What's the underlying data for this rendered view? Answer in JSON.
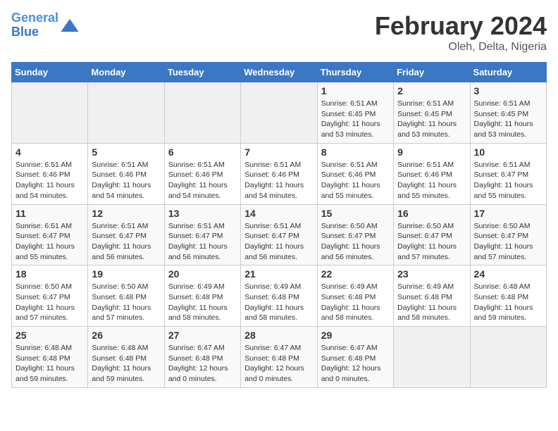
{
  "logo": {
    "line1": "General",
    "line2": "Blue"
  },
  "title": "February 2024",
  "subtitle": "Oleh, Delta, Nigeria",
  "weekdays": [
    "Sunday",
    "Monday",
    "Tuesday",
    "Wednesday",
    "Thursday",
    "Friday",
    "Saturday"
  ],
  "weeks": [
    [
      {
        "day": "",
        "empty": true
      },
      {
        "day": "",
        "empty": true
      },
      {
        "day": "",
        "empty": true
      },
      {
        "day": "",
        "empty": true
      },
      {
        "day": "1",
        "sunrise": "6:51 AM",
        "sunset": "6:45 PM",
        "daylight": "11 hours and 53 minutes."
      },
      {
        "day": "2",
        "sunrise": "6:51 AM",
        "sunset": "6:45 PM",
        "daylight": "11 hours and 53 minutes."
      },
      {
        "day": "3",
        "sunrise": "6:51 AM",
        "sunset": "6:45 PM",
        "daylight": "11 hours and 53 minutes."
      }
    ],
    [
      {
        "day": "4",
        "sunrise": "6:51 AM",
        "sunset": "6:46 PM",
        "daylight": "11 hours and 54 minutes."
      },
      {
        "day": "5",
        "sunrise": "6:51 AM",
        "sunset": "6:46 PM",
        "daylight": "11 hours and 54 minutes."
      },
      {
        "day": "6",
        "sunrise": "6:51 AM",
        "sunset": "6:46 PM",
        "daylight": "11 hours and 54 minutes."
      },
      {
        "day": "7",
        "sunrise": "6:51 AM",
        "sunset": "6:46 PM",
        "daylight": "11 hours and 54 minutes."
      },
      {
        "day": "8",
        "sunrise": "6:51 AM",
        "sunset": "6:46 PM",
        "daylight": "11 hours and 55 minutes."
      },
      {
        "day": "9",
        "sunrise": "6:51 AM",
        "sunset": "6:46 PM",
        "daylight": "11 hours and 55 minutes."
      },
      {
        "day": "10",
        "sunrise": "6:51 AM",
        "sunset": "6:47 PM",
        "daylight": "11 hours and 55 minutes."
      }
    ],
    [
      {
        "day": "11",
        "sunrise": "6:51 AM",
        "sunset": "6:47 PM",
        "daylight": "11 hours and 55 minutes."
      },
      {
        "day": "12",
        "sunrise": "6:51 AM",
        "sunset": "6:47 PM",
        "daylight": "11 hours and 56 minutes."
      },
      {
        "day": "13",
        "sunrise": "6:51 AM",
        "sunset": "6:47 PM",
        "daylight": "11 hours and 56 minutes."
      },
      {
        "day": "14",
        "sunrise": "6:51 AM",
        "sunset": "6:47 PM",
        "daylight": "11 hours and 56 minutes."
      },
      {
        "day": "15",
        "sunrise": "6:50 AM",
        "sunset": "6:47 PM",
        "daylight": "11 hours and 56 minutes."
      },
      {
        "day": "16",
        "sunrise": "6:50 AM",
        "sunset": "6:47 PM",
        "daylight": "11 hours and 57 minutes."
      },
      {
        "day": "17",
        "sunrise": "6:50 AM",
        "sunset": "6:47 PM",
        "daylight": "11 hours and 57 minutes."
      }
    ],
    [
      {
        "day": "18",
        "sunrise": "6:50 AM",
        "sunset": "6:47 PM",
        "daylight": "11 hours and 57 minutes."
      },
      {
        "day": "19",
        "sunrise": "6:50 AM",
        "sunset": "6:48 PM",
        "daylight": "11 hours and 57 minutes."
      },
      {
        "day": "20",
        "sunrise": "6:49 AM",
        "sunset": "6:48 PM",
        "daylight": "11 hours and 58 minutes."
      },
      {
        "day": "21",
        "sunrise": "6:49 AM",
        "sunset": "6:48 PM",
        "daylight": "11 hours and 58 minutes."
      },
      {
        "day": "22",
        "sunrise": "6:49 AM",
        "sunset": "6:48 PM",
        "daylight": "11 hours and 58 minutes."
      },
      {
        "day": "23",
        "sunrise": "6:49 AM",
        "sunset": "6:48 PM",
        "daylight": "11 hours and 58 minutes."
      },
      {
        "day": "24",
        "sunrise": "6:48 AM",
        "sunset": "6:48 PM",
        "daylight": "11 hours and 59 minutes."
      }
    ],
    [
      {
        "day": "25",
        "sunrise": "6:48 AM",
        "sunset": "6:48 PM",
        "daylight": "11 hours and 59 minutes."
      },
      {
        "day": "26",
        "sunrise": "6:48 AM",
        "sunset": "6:48 PM",
        "daylight": "11 hours and 59 minutes."
      },
      {
        "day": "27",
        "sunrise": "6:47 AM",
        "sunset": "6:48 PM",
        "daylight": "12 hours and 0 minutes."
      },
      {
        "day": "28",
        "sunrise": "6:47 AM",
        "sunset": "6:48 PM",
        "daylight": "12 hours and 0 minutes."
      },
      {
        "day": "29",
        "sunrise": "6:47 AM",
        "sunset": "6:48 PM",
        "daylight": "12 hours and 0 minutes."
      },
      {
        "day": "",
        "empty": true
      },
      {
        "day": "",
        "empty": true
      }
    ]
  ],
  "labels": {
    "sunrise": "Sunrise:",
    "sunset": "Sunset:",
    "daylight": "Daylight:"
  }
}
